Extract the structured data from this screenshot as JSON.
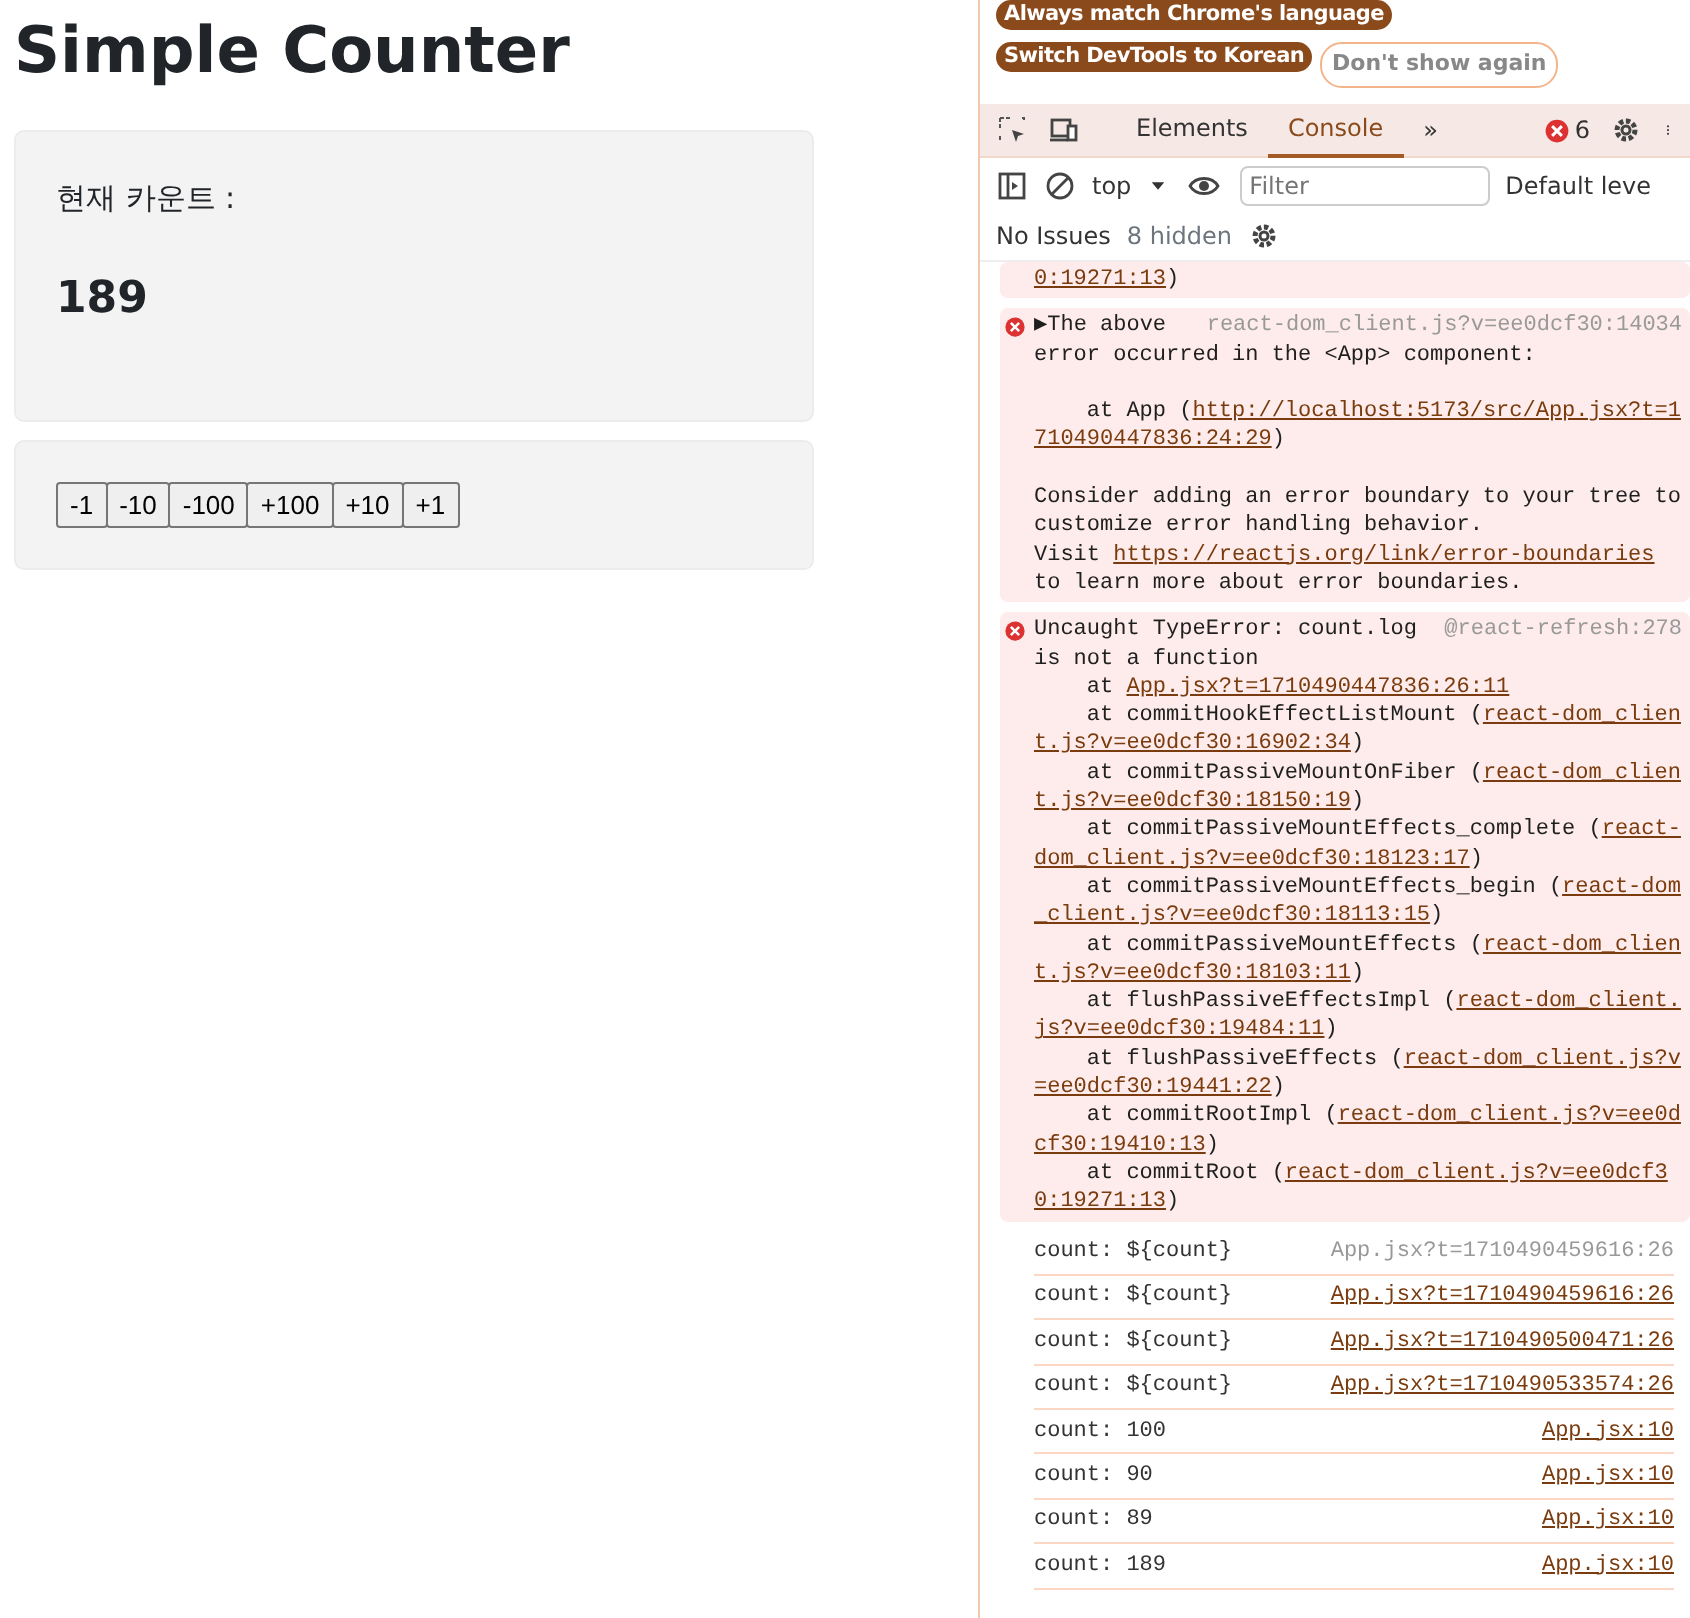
{
  "app": {
    "title": "Simple Counter",
    "label": "현재 카운트 :",
    "count": "189",
    "buttons": [
      "-1",
      "-10",
      "-100",
      "+100",
      "+10",
      "+1"
    ]
  },
  "devtools": {
    "banner": {
      "buttons": [
        {
          "label": "Always match Chrome's language",
          "kind": "filled"
        },
        {
          "label": "Switch DevTools to Korean",
          "kind": "filled"
        },
        {
          "label": "Don't show again",
          "kind": "outline"
        }
      ]
    },
    "tabs": [
      {
        "label": "Elements",
        "selected": false
      },
      {
        "label": "Console",
        "selected": true
      }
    ],
    "more_tabs": "»",
    "error_count": "6",
    "context": "top",
    "filter": {
      "placeholder": "Filter"
    },
    "levels": "Default leve",
    "issues": "No Issues",
    "hidden": "8 hidden",
    "messages": [
      {
        "kind": "error",
        "icon": false,
        "lines": [
          {
            "segments": [
              {
                "kind": "link",
                "text": "0:19271:13"
              },
              {
                "kind": "text",
                "text": ")"
              }
            ]
          }
        ]
      },
      {
        "kind": "error",
        "icon": true,
        "lines": [
          {
            "segments": [
              {
                "kind": "expander",
                "text": "▶"
              },
              {
                "kind": "text",
                "text": "The above "
              },
              {
                "kind": "source",
                "text": "react-dom_client.js?v=ee0dcf30:14034"
              }
            ]
          },
          {
            "segments": [
              {
                "kind": "text",
                "text": "error occurred in the <App> component:"
              }
            ]
          },
          {
            "kind": "blank"
          },
          {
            "segments": [
              {
                "kind": "text",
                "text": "    at App ("
              },
              {
                "kind": "link",
                "text": "http://localhost:5173/src/App.jsx?t=1"
              }
            ]
          },
          {
            "segments": [
              {
                "kind": "link",
                "text": "710490447836:24:29"
              },
              {
                "kind": "text",
                "text": ")"
              }
            ]
          },
          {
            "kind": "blank"
          },
          {
            "segments": [
              {
                "kind": "text",
                "text": "Consider adding an error boundary to your tree to"
              }
            ]
          },
          {
            "segments": [
              {
                "kind": "text",
                "text": "customize error handling behavior."
              }
            ]
          },
          {
            "segments": [
              {
                "kind": "text",
                "text": "Visit "
              },
              {
                "kind": "link",
                "text": "https://reactjs.org/link/error-boundaries"
              }
            ]
          },
          {
            "segments": [
              {
                "kind": "text",
                "text": "to learn more about error boundaries."
              }
            ]
          }
        ]
      },
      {
        "kind": "error",
        "icon": true,
        "lines": [
          {
            "segments": [
              {
                "kind": "text",
                "text": "Uncaught TypeError: count.log "
              },
              {
                "kind": "source",
                "text": "@react-refresh:278"
              }
            ]
          },
          {
            "segments": [
              {
                "kind": "text",
                "text": "is not a function"
              }
            ]
          },
          {
            "segments": [
              {
                "kind": "text",
                "text": "    at "
              },
              {
                "kind": "link",
                "text": "App.jsx?t=1710490447836:26:11"
              }
            ]
          },
          {
            "segments": [
              {
                "kind": "text",
                "text": "    at commitHookEffectListMount ("
              },
              {
                "kind": "link",
                "text": "react-dom_clien"
              }
            ]
          },
          {
            "segments": [
              {
                "kind": "link",
                "text": "t.js?v=ee0dcf30:16902:34"
              },
              {
                "kind": "text",
                "text": ")"
              }
            ]
          },
          {
            "segments": [
              {
                "kind": "text",
                "text": "    at commitPassiveMountOnFiber ("
              },
              {
                "kind": "link",
                "text": "react-dom_clien"
              }
            ]
          },
          {
            "segments": [
              {
                "kind": "link",
                "text": "t.js?v=ee0dcf30:18150:19"
              },
              {
                "kind": "text",
                "text": ")"
              }
            ]
          },
          {
            "segments": [
              {
                "kind": "text",
                "text": "    at commitPassiveMountEffects_complete ("
              },
              {
                "kind": "link",
                "text": "react-"
              }
            ]
          },
          {
            "segments": [
              {
                "kind": "link",
                "text": "dom_client.js?v=ee0dcf30:18123:17"
              },
              {
                "kind": "text",
                "text": ")"
              }
            ]
          },
          {
            "segments": [
              {
                "kind": "text",
                "text": "    at commitPassiveMountEffects_begin ("
              },
              {
                "kind": "link",
                "text": "react-dom"
              }
            ]
          },
          {
            "segments": [
              {
                "kind": "link",
                "text": "_client.js?v=ee0dcf30:18113:15"
              },
              {
                "kind": "text",
                "text": ")"
              }
            ]
          },
          {
            "segments": [
              {
                "kind": "text",
                "text": "    at commitPassiveMountEffects ("
              },
              {
                "kind": "link",
                "text": "react-dom_clien"
              }
            ]
          },
          {
            "segments": [
              {
                "kind": "link",
                "text": "t.js?v=ee0dcf30:18103:11"
              },
              {
                "kind": "text",
                "text": ")"
              }
            ]
          },
          {
            "segments": [
              {
                "kind": "text",
                "text": "    at flushPassiveEffectsImpl ("
              },
              {
                "kind": "link",
                "text": "react-dom_client."
              }
            ]
          },
          {
            "segments": [
              {
                "kind": "link",
                "text": "js?v=ee0dcf30:19484:11"
              },
              {
                "kind": "text",
                "text": ")"
              }
            ]
          },
          {
            "segments": [
              {
                "kind": "text",
                "text": "    at flushPassiveEffects ("
              },
              {
                "kind": "link",
                "text": "react-dom_client.js?v"
              }
            ]
          },
          {
            "segments": [
              {
                "kind": "link",
                "text": "=ee0dcf30:19441:22"
              },
              {
                "kind": "text",
                "text": ")"
              }
            ]
          },
          {
            "segments": [
              {
                "kind": "text",
                "text": "    at commitRootImpl ("
              },
              {
                "kind": "link",
                "text": "react-dom_client.js?v=ee0d"
              }
            ]
          },
          {
            "segments": [
              {
                "kind": "link",
                "text": "cf30:19410:13"
              },
              {
                "kind": "text",
                "text": ")"
              }
            ]
          },
          {
            "segments": [
              {
                "kind": "text",
                "text": "    at commitRoot ("
              },
              {
                "kind": "link",
                "text": "react-dom_client.js?v=ee0dcf3"
              }
            ]
          },
          {
            "segments": [
              {
                "kind": "link",
                "text": "0:19271:13"
              },
              {
                "kind": "text",
                "text": ")"
              }
            ]
          }
        ]
      },
      {
        "kind": "log",
        "text": "count: ${count}",
        "source": "App.jsx?t=1710490459616:26",
        "underlined": false
      },
      {
        "kind": "log",
        "text": "count: ${count}",
        "source": "App.jsx?t=1710490459616:26",
        "underlined": true
      },
      {
        "kind": "log",
        "text": "count: ${count}",
        "source": "App.jsx?t=1710490500471:26",
        "underlined": true
      },
      {
        "kind": "log",
        "text": "count: ${count}",
        "source": "App.jsx?t=1710490533574:26",
        "underlined": true
      },
      {
        "kind": "log",
        "text": "count: 100",
        "source": "App.jsx:10",
        "underlined": true
      },
      {
        "kind": "log",
        "text": "count: 90",
        "source": "App.jsx:10",
        "underlined": true
      },
      {
        "kind": "log",
        "text": "count: 89",
        "source": "App.jsx:10",
        "underlined": true
      },
      {
        "kind": "log",
        "text": "count: 189",
        "source": "App.jsx:10",
        "underlined": true
      }
    ]
  }
}
